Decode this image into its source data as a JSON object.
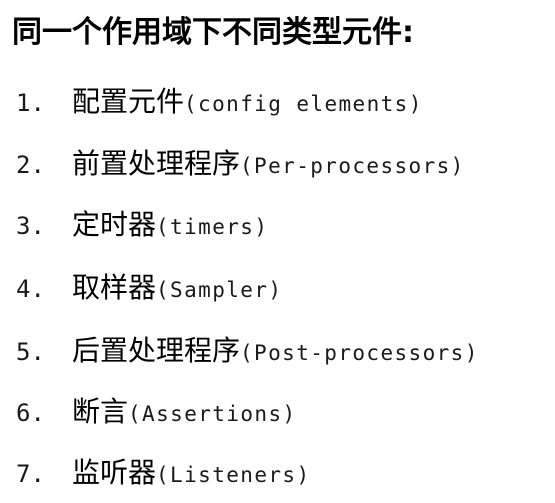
{
  "title": "同一个作用域下不同类型元件:",
  "items": [
    {
      "number": "1.",
      "name": "配置元件",
      "english": "(config elements)"
    },
    {
      "number": "2.",
      "name": "前置处理程序",
      "english": "(Per-processors)"
    },
    {
      "number": "3.",
      "name": "定时器",
      "english": "(timers)"
    },
    {
      "number": "4.",
      "name": "取样器",
      "english": "(Sampler)"
    },
    {
      "number": "5.",
      "name": "后置处理程序",
      "english": "(Post-processors)"
    },
    {
      "number": "6.",
      "name": "断言",
      "english": "(Assertions)"
    },
    {
      "number": "7.",
      "name": "监听器",
      "english": "(Listeners)"
    }
  ]
}
